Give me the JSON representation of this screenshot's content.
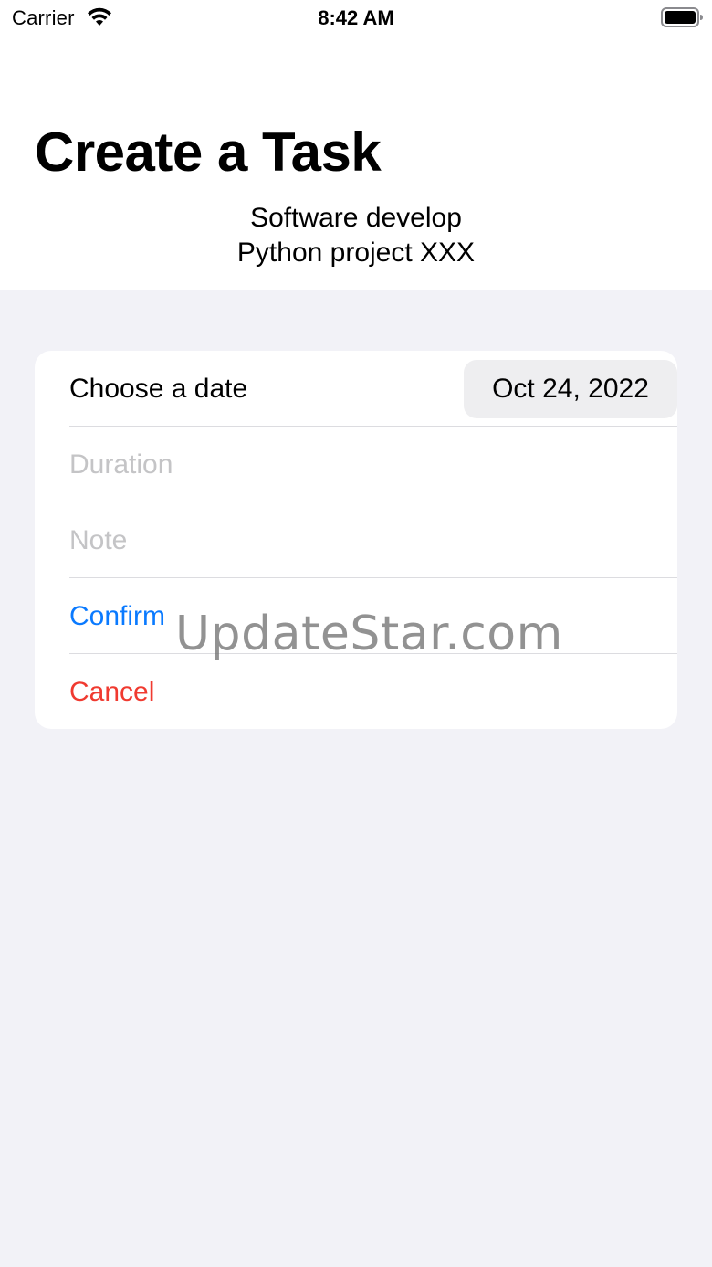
{
  "status_bar": {
    "carrier": "Carrier",
    "time": "8:42 AM",
    "icons": [
      "wifi-icon",
      "battery-icon"
    ]
  },
  "header": {
    "title": "Create a Task",
    "subtitle_line1": "Software develop",
    "subtitle_line2": "Python project XXX"
  },
  "form": {
    "date_label": "Choose a date",
    "date_value": "Oct 24, 2022",
    "duration_placeholder": "Duration",
    "note_placeholder": "Note",
    "confirm_label": "Confirm",
    "cancel_label": "Cancel"
  },
  "watermark": "UpdateStar.com",
  "colors": {
    "accent_blue": "#0a7aff",
    "destructive_red": "#f03a30",
    "placeholder_gray": "#c4c4c6",
    "background": "#f2f2f7"
  }
}
